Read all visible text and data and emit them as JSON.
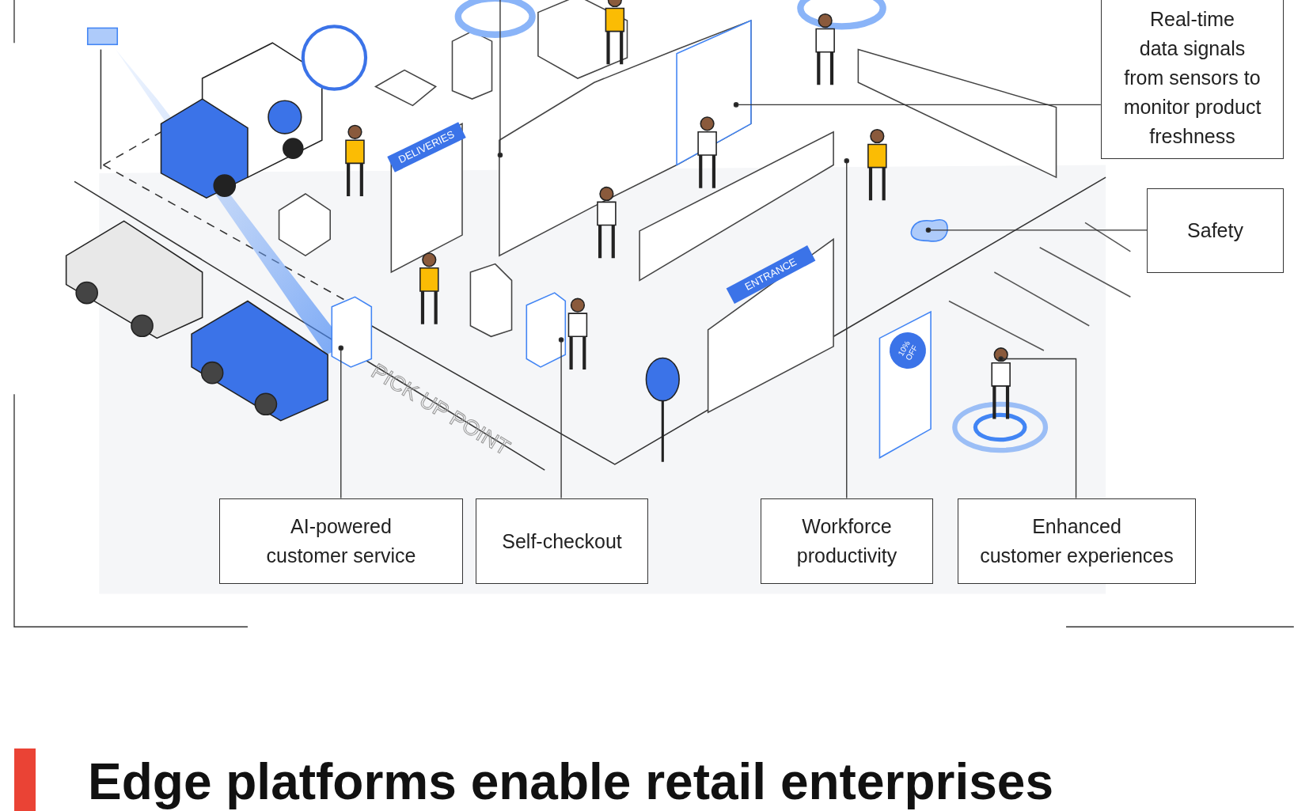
{
  "illustration": {
    "signs": [
      {
        "text": "DELIVERIES"
      },
      {
        "text": "ENTRANCE"
      }
    ],
    "ground_text": "PICK UP POINT",
    "promo_badge": "10%\nOFF"
  },
  "callouts": [
    {
      "text": "Real-time\ndata signals\nfrom sensors to\nmonitor product\nfreshness"
    },
    {
      "text": "Safety"
    },
    {
      "text": "AI-powered\ncustomer service"
    },
    {
      "text": "Self-checkout"
    },
    {
      "text": "Workforce\nproductivity"
    },
    {
      "text": "Enhanced\ncustomer experiences"
    }
  ],
  "heading": "Edge platforms enable retail enterprises"
}
